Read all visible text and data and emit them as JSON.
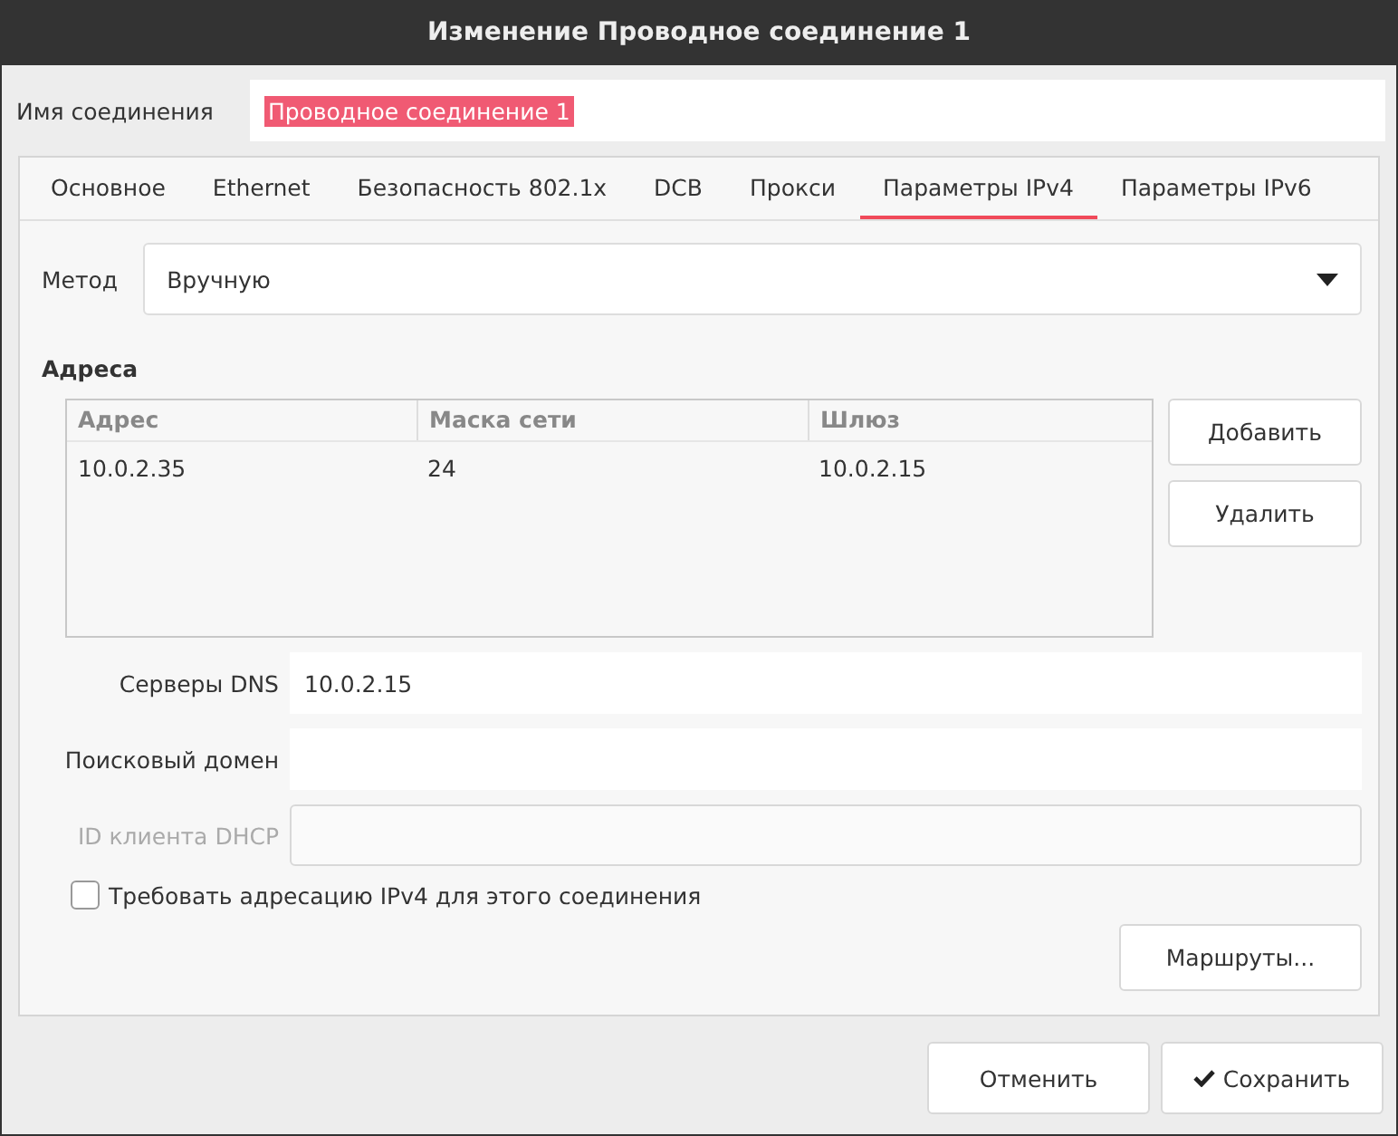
{
  "window": {
    "title": "Изменение Проводное соединение 1"
  },
  "connection_name": {
    "label": "Имя соединения",
    "value": "Проводное соединение 1",
    "text_selected": true
  },
  "tabs": [
    {
      "label": "Основное",
      "selected": false
    },
    {
      "label": "Ethernet",
      "selected": false
    },
    {
      "label": "Безопасность 802.1x",
      "selected": false
    },
    {
      "label": "DCB",
      "selected": false
    },
    {
      "label": "Прокси",
      "selected": false
    },
    {
      "label": "Параметры IPv4",
      "selected": true
    },
    {
      "label": "Параметры IPv6",
      "selected": false
    }
  ],
  "method": {
    "label": "Метод",
    "value": "Вручную"
  },
  "addresses": {
    "title": "Адреса",
    "columns": [
      "Адрес",
      "Маска сети",
      "Шлюз"
    ],
    "rows": [
      [
        "10.0.2.35",
        "24",
        "10.0.2.15"
      ]
    ],
    "buttons": [
      "Добавить",
      "Удалить"
    ]
  },
  "fields": [
    {
      "label": "Серверы DNS",
      "value": "10.0.2.15",
      "disabled": false
    },
    {
      "label": "Поисковый домен",
      "disabled": false
    },
    {
      "label": "ID клиента DHCP",
      "disabled": true
    }
  ],
  "require_ipv4": {
    "label": "Требовать адресацию IPv4 для этого соединения",
    "checked": false
  },
  "routes_button": "Маршруты...",
  "buttons": [
    {
      "label": "Отменить",
      "kind": "plain"
    },
    {
      "label": "Сохранить",
      "kind": "confirm"
    }
  ]
}
